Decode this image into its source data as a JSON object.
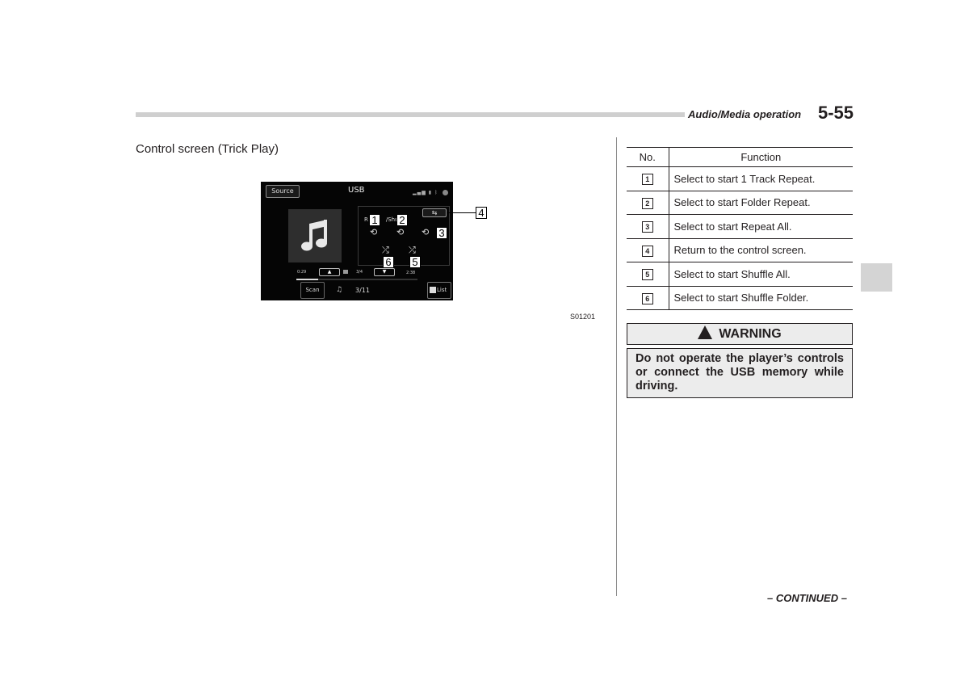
{
  "header": {
    "section": "Audio/Media operation",
    "page": "5-55"
  },
  "section_title": "Control screen (Trick Play)",
  "screen": {
    "source_button": "Source",
    "title": "USB",
    "status_icons": "signal-icon battery-icon bluetooth-icon",
    "return_button_glyph": "⇆",
    "panel_label_left": "R",
    "panel_label_right": "/Shu",
    "elapsed_time": "0:29",
    "total_time": "2:38",
    "folder_count": "3/4",
    "up_glyph": "▲",
    "down_glyph": "▼",
    "scan_button": "Scan",
    "note_glyph": "♫",
    "track_count": "3/11",
    "list_button": "List",
    "progress": 0.18,
    "icons": {
      "track_repeat": "⟲",
      "folder_repeat": "⟲",
      "repeat_all": "⟲",
      "shuffle_folder": "⤮",
      "shuffle_all": "⤮"
    }
  },
  "callouts": [
    "1",
    "2",
    "3",
    "4",
    "5",
    "6"
  ],
  "figure_id": "S01201",
  "table": {
    "headers": [
      "No.",
      "Function"
    ],
    "rows": [
      {
        "no": "1",
        "function": "Select to start 1 Track Repeat."
      },
      {
        "no": "2",
        "function": "Select to start Folder Repeat."
      },
      {
        "no": "3",
        "function": "Select to start Repeat All."
      },
      {
        "no": "4",
        "function": "Return to the control screen."
      },
      {
        "no": "5",
        "function": "Select to start Shuffle All."
      },
      {
        "no": "6",
        "function": "Select to start Shuffle Folder."
      }
    ]
  },
  "warning": {
    "title": "WARNING",
    "body": "Do not operate the player’s controls or connect the USB memory while driving."
  },
  "footer": {
    "continued": "– CONTINUED –"
  }
}
